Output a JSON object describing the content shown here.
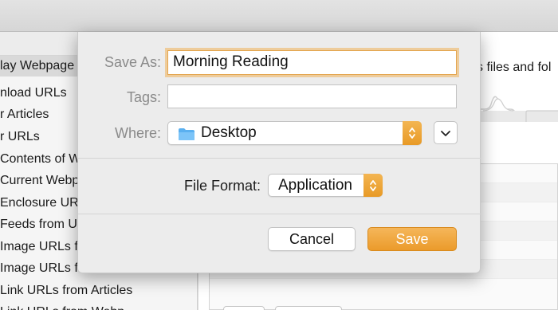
{
  "sidebar": {
    "items": [
      {
        "label": "lay Webpage",
        "selected": true
      },
      {
        "label": "nload URLs"
      },
      {
        "label": "r Articles"
      },
      {
        "label": "r URLs"
      },
      {
        "label": "Contents of W"
      },
      {
        "label": "Current Webp"
      },
      {
        "label": "Enclosure UR"
      },
      {
        "label": "Feeds from U"
      },
      {
        "label": "Image URLs f"
      },
      {
        "label": "Image URLs f"
      },
      {
        "label": "Link URLs from Articles"
      },
      {
        "label": "Link URLs from Webp"
      }
    ]
  },
  "right_pane": {
    "text": "s files and fol"
  },
  "dialog": {
    "save_as_label": "Save As:",
    "save_as_value": "Morning Reading",
    "tags_label": "Tags:",
    "tags_value": "",
    "where_label": "Where:",
    "where_value": "Desktop",
    "file_format_label": "File Format:",
    "file_format_value": "Application",
    "cancel_label": "Cancel",
    "save_label": "Save"
  },
  "colors": {
    "accent": "#eb9b2b",
    "focus_ring": "#f1b25a",
    "folder": "#5ab0f0"
  }
}
